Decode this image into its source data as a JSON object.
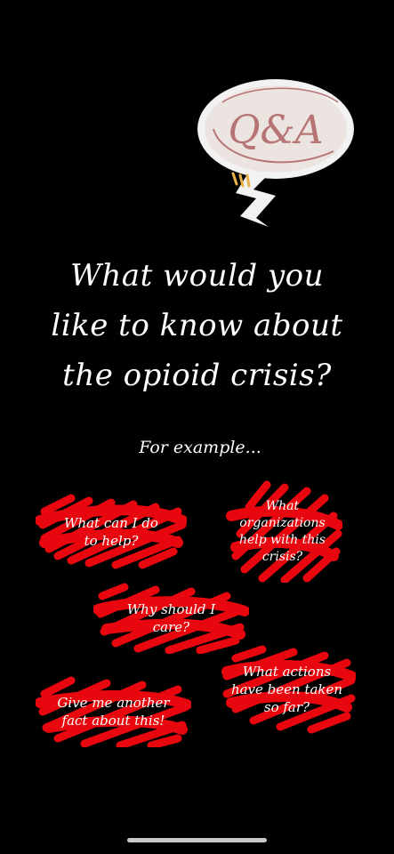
{
  "sticker": {
    "text": "Q&A",
    "icon": "qa-speech-bubble-icon",
    "colors": {
      "bubble": "#ece4e0",
      "ink": "#b77474",
      "outline": "#f2f2f2"
    }
  },
  "headline": {
    "line1": "What would you",
    "line2": "like to know about",
    "line3": "the opioid crisis?"
  },
  "example_label": "For example...",
  "questions": [
    {
      "id": "help",
      "line1": "What can I do",
      "line2": "to help?"
    },
    {
      "id": "orgs",
      "line1": "What",
      "line2": "organizations",
      "line3": "help with this",
      "line4": "crisis?"
    },
    {
      "id": "care",
      "line1": "Why should I",
      "line2": "care?"
    },
    {
      "id": "actions",
      "line1": "What actions",
      "line2": "have been taken",
      "line3": "so far?"
    },
    {
      "id": "fact",
      "line1": "Give me another",
      "line2": "fact about this!"
    }
  ],
  "colors": {
    "background": "#000000",
    "scribble": "#e8070e",
    "text": "#ffffff",
    "home_indicator": "#c9c9c9"
  }
}
